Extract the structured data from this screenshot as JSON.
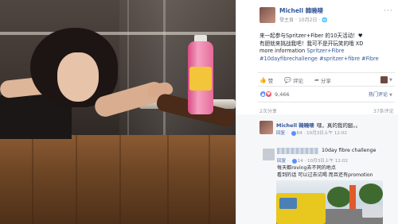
{
  "post": {
    "author": "Michell 韓曉嘜",
    "page_label": "發主頁",
    "date": "10月2日",
    "privacy_icon": "globe-icon",
    "more_icon": "ellipsis-icon",
    "text_lines": [
      "来一起参与Spritzer+Fiber 的10天活动！♥",
      "有胆就来挑战我吧！我可不是开玩笑的哦 XD",
      "more information "
    ],
    "link_inline": "Spritzer+Fibre",
    "hashtags": "#10dayfibrechallenge #spritzer+fibre #Fibre"
  },
  "actions": {
    "like": "赞",
    "comment": "评论",
    "share": "分享",
    "like_icon": "thumbs-up-icon",
    "comment_icon": "speech-bubble-icon",
    "share_icon": "share-arrow-icon"
  },
  "stats": {
    "reaction_count": "9,466",
    "top_comments_label": "热门评论",
    "shares": "2次分享",
    "comments": "37条评论"
  },
  "comments": [
    {
      "author": "Michell 韓曉嘜",
      "text": "嘿，真的我的腿。。",
      "reply_label": "回复",
      "like_count": "64",
      "time": "10月3日上午 12:02"
    },
    {
      "title": "10day fibre challenge",
      "reply_label": "回复",
      "like_count": "14",
      "time": "10月3日上午 12:02",
      "lines": [
        "每天都roving去不同的地点",
        "看到的话 可以过去试喝 而且还有promotion"
      ]
    }
  ],
  "colors": {
    "link": "#365899",
    "meta": "#90949c",
    "text": "#1d2129",
    "like_reaction": "#5890ff",
    "love_reaction": "#f25268"
  }
}
